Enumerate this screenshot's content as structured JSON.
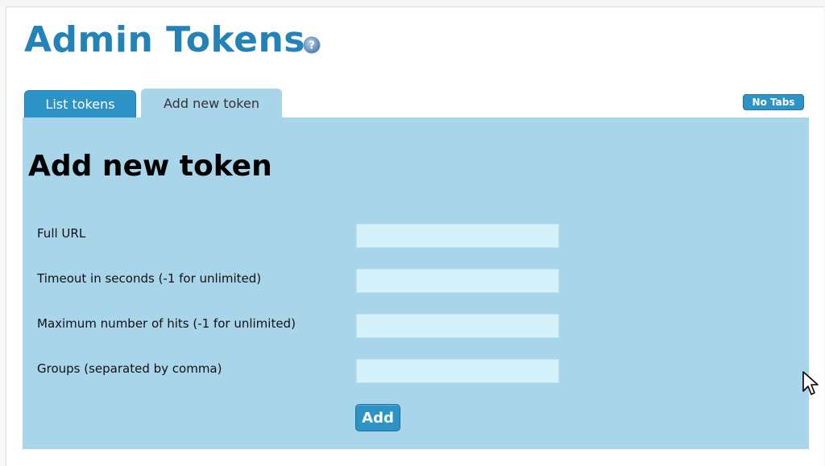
{
  "page": {
    "title": "Admin Tokens",
    "help_icon": "question-circle-icon"
  },
  "tabs": [
    {
      "label": "List tokens",
      "active": false
    },
    {
      "label": "Add new token",
      "active": true
    }
  ],
  "no_tabs_label": "No Tabs",
  "form": {
    "heading": "Add new token",
    "fields": [
      {
        "label": "Full URL",
        "value": ""
      },
      {
        "label": "Timeout in seconds (-1 for unlimited)",
        "value": ""
      },
      {
        "label": "Maximum number of hits (-1 for unlimited)",
        "value": ""
      },
      {
        "label": "Groups (separated by comma)",
        "value": ""
      }
    ],
    "submit_label": "Add"
  },
  "colors": {
    "title": "#2382b6",
    "tab_active_bg": "#2d93c7",
    "panel_bg": "#a9d5ea",
    "input_bg": "#d4f0f9"
  },
  "cursor_icon": "mouse-pointer-icon"
}
